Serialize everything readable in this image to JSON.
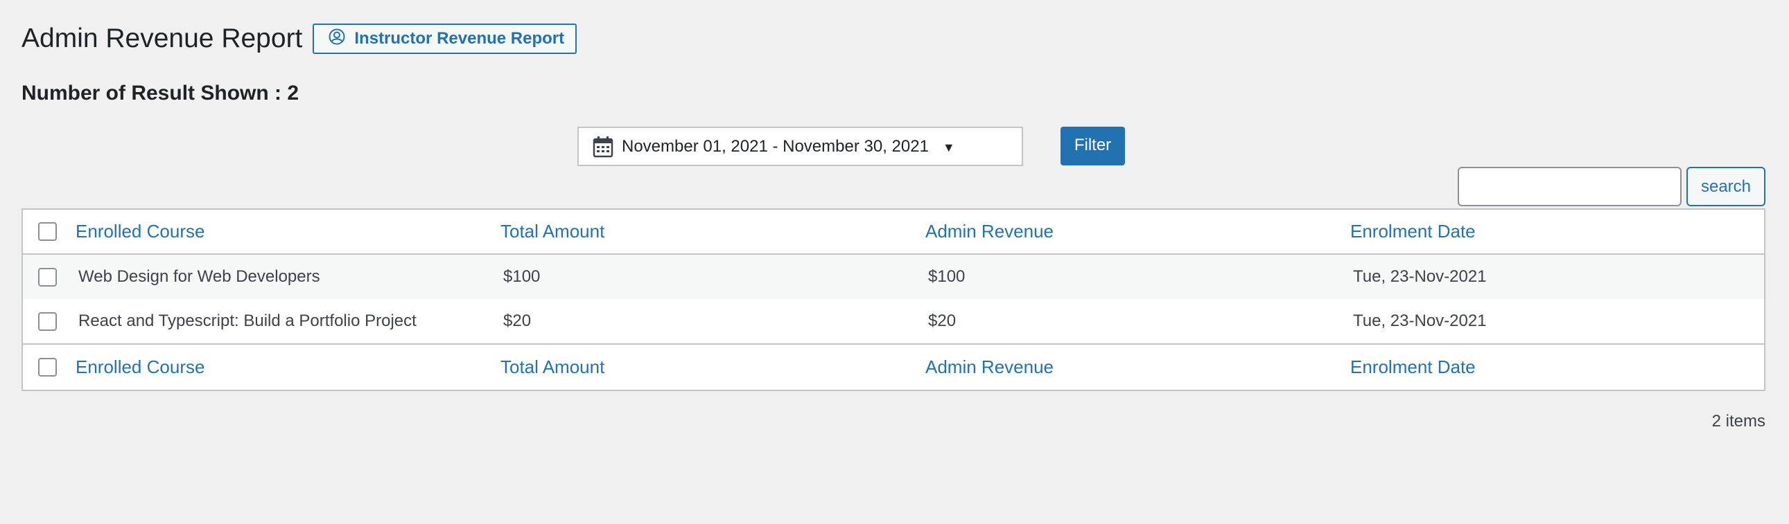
{
  "page_title": "Admin Revenue Report",
  "instructor_button_label": "Instructor Revenue Report",
  "result_count": "Number of Result Shown : 2",
  "date_range": "November 01, 2021 - November 30, 2021",
  "filter_label": "Filter",
  "search": {
    "value": "",
    "button_label": "search"
  },
  "table": {
    "columns": [
      "Enrolled Course",
      "Total Amount",
      "Admin Revenue",
      "Enrolment Date"
    ],
    "rows": [
      [
        "Web Design for Web Developers",
        "$100",
        "$100",
        "Tue, 23-Nov-2021"
      ],
      [
        "React and Typescript: Build a Portfolio Project",
        "$20",
        "$20",
        "Tue, 23-Nov-2021"
      ]
    ]
  },
  "items_count": "2 items",
  "colors": {
    "accent": "#2271b1",
    "background": "#f0f0f1",
    "border": "#c3c4c7"
  },
  "icons": {
    "instructor_button": "user-circle-icon",
    "date_picker": "calendar-icon",
    "dropdown": "caret-down-icon"
  }
}
